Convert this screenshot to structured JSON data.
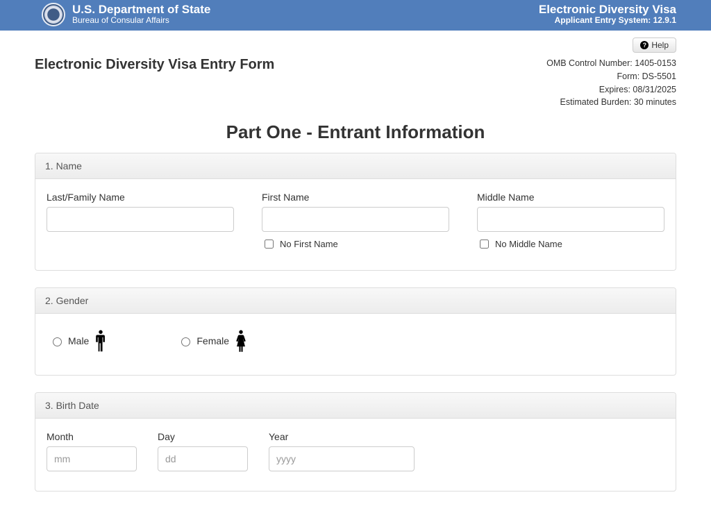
{
  "header": {
    "dept": "U.S. Department of State",
    "bureau": "Bureau of Consular Affairs",
    "system_title": "Electronic Diversity Visa",
    "system_sub": "Applicant Entry System: 12.9.1"
  },
  "help_label": "Help",
  "page_title": "Electronic Diversity Visa Entry Form",
  "meta": {
    "omb": "OMB Control Number: 1405-0153",
    "form": "Form: DS-5501",
    "expires": "Expires: 08/31/2025",
    "burden": "Estimated Burden: 30 minutes"
  },
  "part_title": "Part One - Entrant Information",
  "sections": {
    "name": {
      "heading": "1. Name",
      "last_label": "Last/Family Name",
      "first_label": "First Name",
      "middle_label": "Middle Name",
      "no_first": "No First Name",
      "no_middle": "No Middle Name",
      "values": {
        "last": "",
        "first": "",
        "middle": ""
      }
    },
    "gender": {
      "heading": "2. Gender",
      "male": "Male",
      "female": "Female"
    },
    "birth": {
      "heading": "3. Birth Date",
      "month_label": "Month",
      "day_label": "Day",
      "year_label": "Year",
      "placeholders": {
        "month": "mm",
        "day": "dd",
        "year": "yyyy"
      },
      "values": {
        "month": "",
        "day": "",
        "year": ""
      }
    }
  }
}
